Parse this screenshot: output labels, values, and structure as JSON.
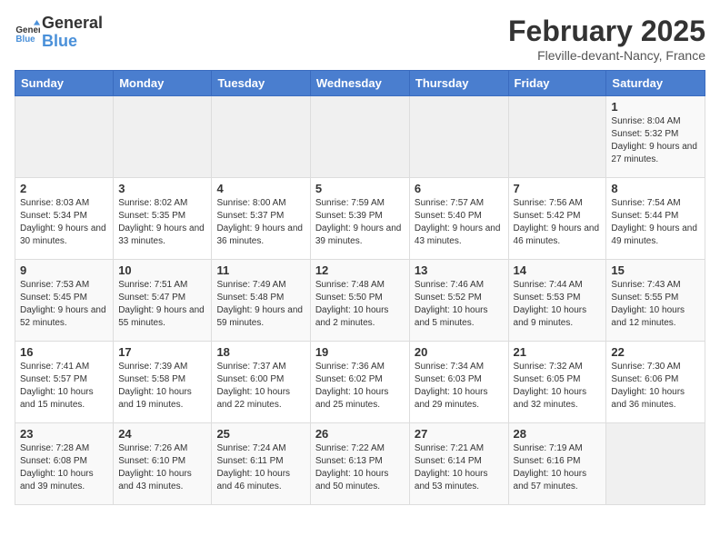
{
  "logo": {
    "general": "General",
    "blue": "Blue"
  },
  "header": {
    "month": "February 2025",
    "location": "Fleville-devant-Nancy, France"
  },
  "weekdays": [
    "Sunday",
    "Monday",
    "Tuesday",
    "Wednesday",
    "Thursday",
    "Friday",
    "Saturday"
  ],
  "weeks": [
    [
      {
        "day": "",
        "info": ""
      },
      {
        "day": "",
        "info": ""
      },
      {
        "day": "",
        "info": ""
      },
      {
        "day": "",
        "info": ""
      },
      {
        "day": "",
        "info": ""
      },
      {
        "day": "",
        "info": ""
      },
      {
        "day": "1",
        "info": "Sunrise: 8:04 AM\nSunset: 5:32 PM\nDaylight: 9 hours and 27 minutes."
      }
    ],
    [
      {
        "day": "2",
        "info": "Sunrise: 8:03 AM\nSunset: 5:34 PM\nDaylight: 9 hours and 30 minutes."
      },
      {
        "day": "3",
        "info": "Sunrise: 8:02 AM\nSunset: 5:35 PM\nDaylight: 9 hours and 33 minutes."
      },
      {
        "day": "4",
        "info": "Sunrise: 8:00 AM\nSunset: 5:37 PM\nDaylight: 9 hours and 36 minutes."
      },
      {
        "day": "5",
        "info": "Sunrise: 7:59 AM\nSunset: 5:39 PM\nDaylight: 9 hours and 39 minutes."
      },
      {
        "day": "6",
        "info": "Sunrise: 7:57 AM\nSunset: 5:40 PM\nDaylight: 9 hours and 43 minutes."
      },
      {
        "day": "7",
        "info": "Sunrise: 7:56 AM\nSunset: 5:42 PM\nDaylight: 9 hours and 46 minutes."
      },
      {
        "day": "8",
        "info": "Sunrise: 7:54 AM\nSunset: 5:44 PM\nDaylight: 9 hours and 49 minutes."
      }
    ],
    [
      {
        "day": "9",
        "info": "Sunrise: 7:53 AM\nSunset: 5:45 PM\nDaylight: 9 hours and 52 minutes."
      },
      {
        "day": "10",
        "info": "Sunrise: 7:51 AM\nSunset: 5:47 PM\nDaylight: 9 hours and 55 minutes."
      },
      {
        "day": "11",
        "info": "Sunrise: 7:49 AM\nSunset: 5:48 PM\nDaylight: 9 hours and 59 minutes."
      },
      {
        "day": "12",
        "info": "Sunrise: 7:48 AM\nSunset: 5:50 PM\nDaylight: 10 hours and 2 minutes."
      },
      {
        "day": "13",
        "info": "Sunrise: 7:46 AM\nSunset: 5:52 PM\nDaylight: 10 hours and 5 minutes."
      },
      {
        "day": "14",
        "info": "Sunrise: 7:44 AM\nSunset: 5:53 PM\nDaylight: 10 hours and 9 minutes."
      },
      {
        "day": "15",
        "info": "Sunrise: 7:43 AM\nSunset: 5:55 PM\nDaylight: 10 hours and 12 minutes."
      }
    ],
    [
      {
        "day": "16",
        "info": "Sunrise: 7:41 AM\nSunset: 5:57 PM\nDaylight: 10 hours and 15 minutes."
      },
      {
        "day": "17",
        "info": "Sunrise: 7:39 AM\nSunset: 5:58 PM\nDaylight: 10 hours and 19 minutes."
      },
      {
        "day": "18",
        "info": "Sunrise: 7:37 AM\nSunset: 6:00 PM\nDaylight: 10 hours and 22 minutes."
      },
      {
        "day": "19",
        "info": "Sunrise: 7:36 AM\nSunset: 6:02 PM\nDaylight: 10 hours and 25 minutes."
      },
      {
        "day": "20",
        "info": "Sunrise: 7:34 AM\nSunset: 6:03 PM\nDaylight: 10 hours and 29 minutes."
      },
      {
        "day": "21",
        "info": "Sunrise: 7:32 AM\nSunset: 6:05 PM\nDaylight: 10 hours and 32 minutes."
      },
      {
        "day": "22",
        "info": "Sunrise: 7:30 AM\nSunset: 6:06 PM\nDaylight: 10 hours and 36 minutes."
      }
    ],
    [
      {
        "day": "23",
        "info": "Sunrise: 7:28 AM\nSunset: 6:08 PM\nDaylight: 10 hours and 39 minutes."
      },
      {
        "day": "24",
        "info": "Sunrise: 7:26 AM\nSunset: 6:10 PM\nDaylight: 10 hours and 43 minutes."
      },
      {
        "day": "25",
        "info": "Sunrise: 7:24 AM\nSunset: 6:11 PM\nDaylight: 10 hours and 46 minutes."
      },
      {
        "day": "26",
        "info": "Sunrise: 7:22 AM\nSunset: 6:13 PM\nDaylight: 10 hours and 50 minutes."
      },
      {
        "day": "27",
        "info": "Sunrise: 7:21 AM\nSunset: 6:14 PM\nDaylight: 10 hours and 53 minutes."
      },
      {
        "day": "28",
        "info": "Sunrise: 7:19 AM\nSunset: 6:16 PM\nDaylight: 10 hours and 57 minutes."
      },
      {
        "day": "",
        "info": ""
      }
    ]
  ]
}
